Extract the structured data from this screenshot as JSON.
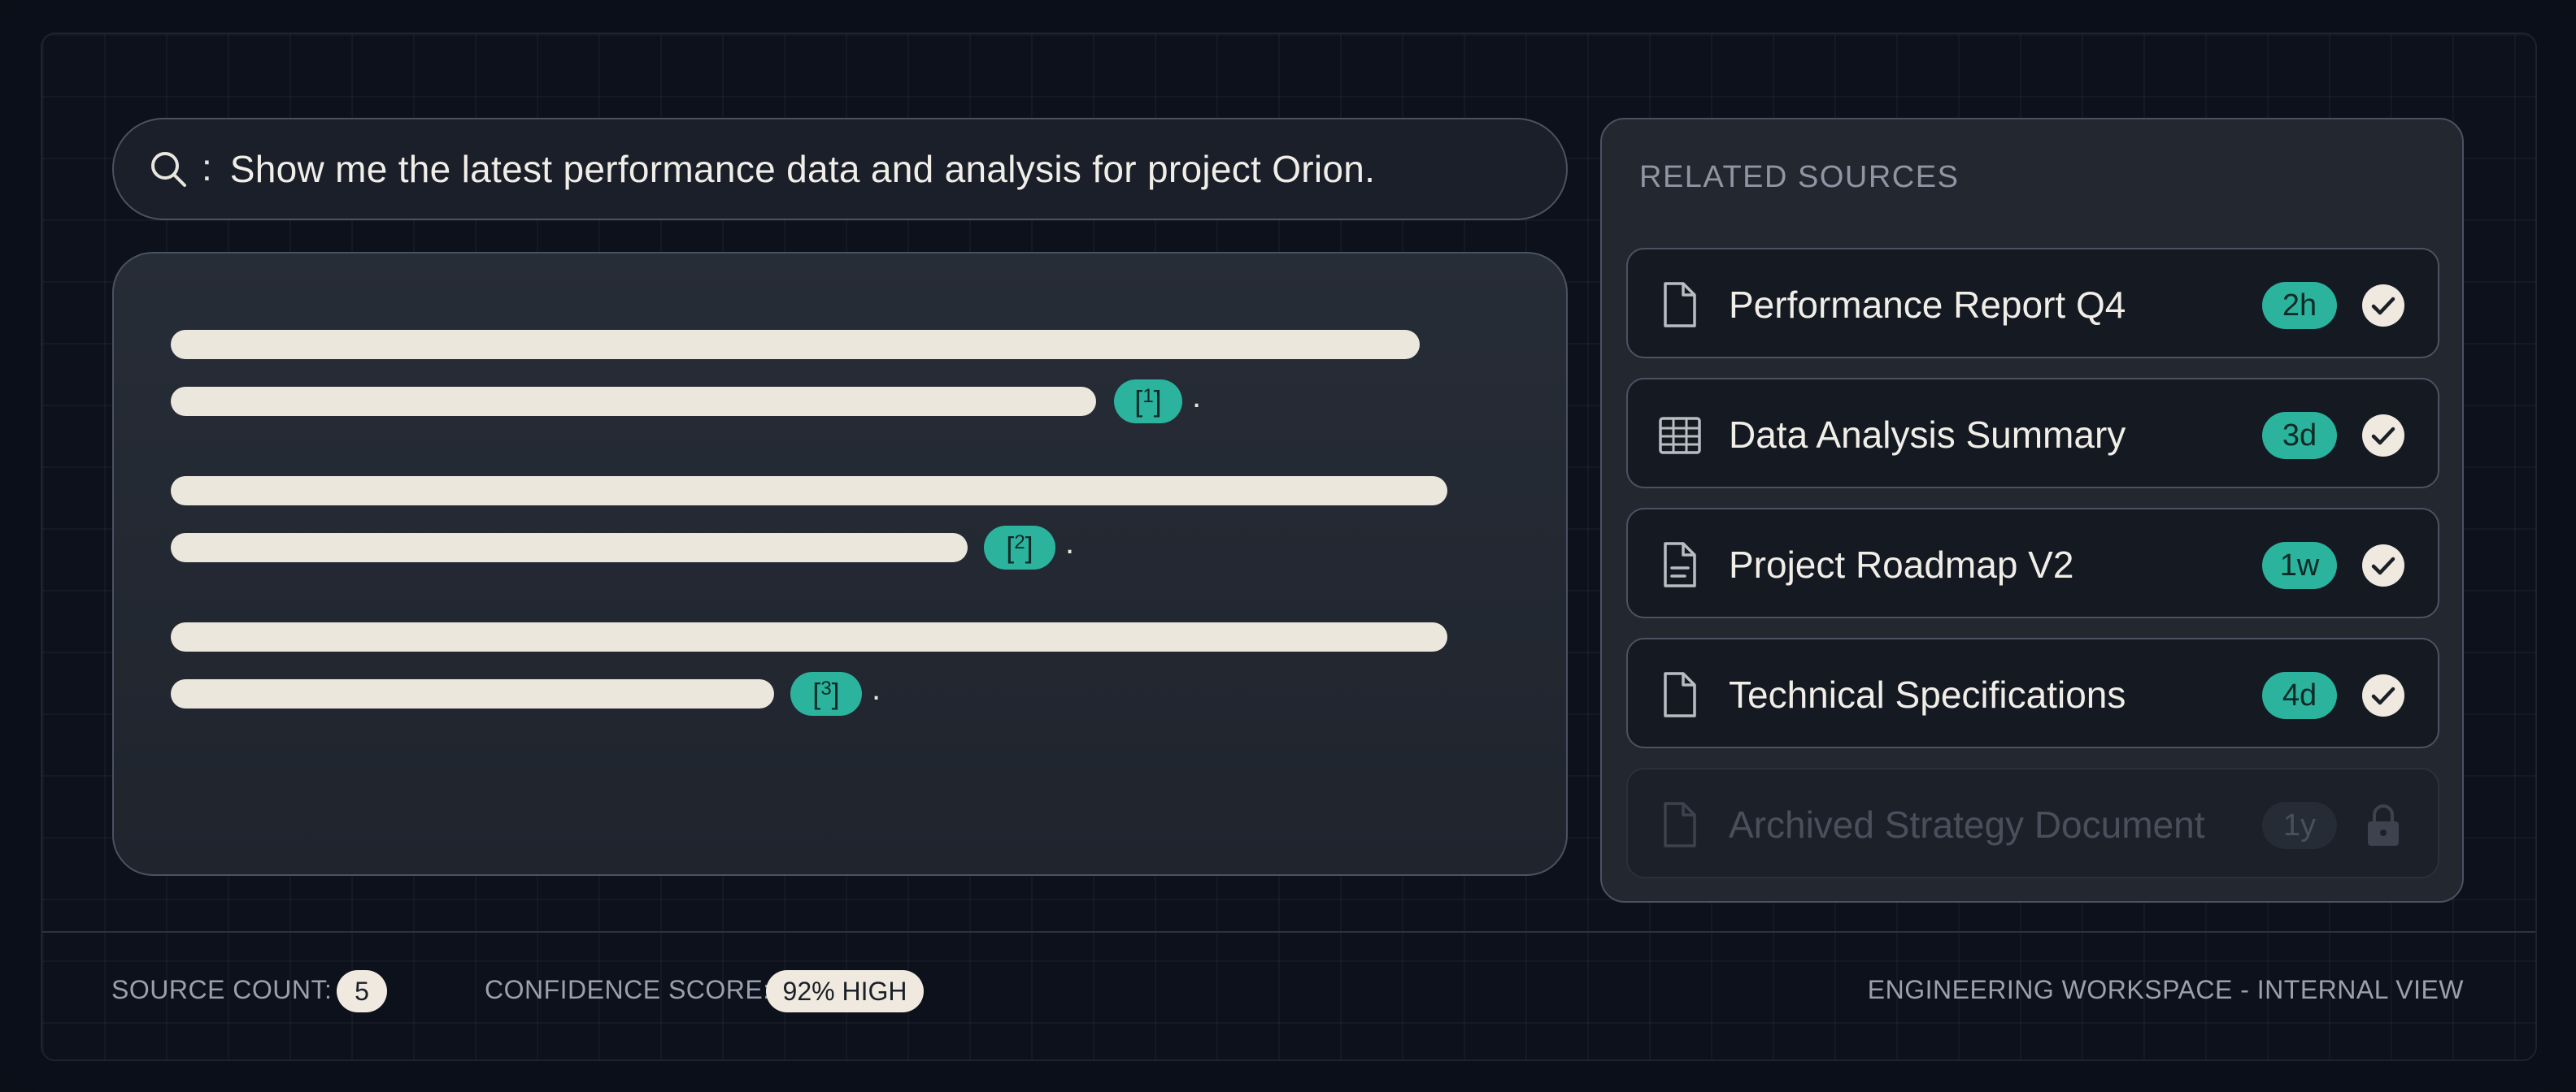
{
  "search": {
    "query": "Show me the latest performance data and analysis for project Orion."
  },
  "answer": {
    "citations": [
      {
        "number": "1"
      },
      {
        "number": "2"
      },
      {
        "number": "3"
      }
    ]
  },
  "sources": {
    "title": "RELATED SOURCES",
    "items": [
      {
        "label": "Performance Report Q4",
        "age": "2h",
        "icon": "document-icon",
        "status": "verified"
      },
      {
        "label": "Data Analysis Summary",
        "age": "3d",
        "icon": "table-icon",
        "status": "verified"
      },
      {
        "label": "Project Roadmap V2",
        "age": "1w",
        "icon": "document-lines-icon",
        "status": "verified"
      },
      {
        "label": "Technical Specifications",
        "age": "4d",
        "icon": "document-icon",
        "status": "verified"
      },
      {
        "label": "Archived Strategy Document",
        "age": "1y",
        "icon": "document-icon",
        "status": "locked"
      }
    ]
  },
  "footer": {
    "source_count_label": "SOURCE COUNT:",
    "source_count_value": "5",
    "confidence_label": "CONFIDENCE SCORE:",
    "confidence_value": "92% HIGH",
    "workspace_label": "ENGINEERING WORKSPACE - INTERNAL VIEW"
  },
  "colors": {
    "accent": "#2bb39e",
    "background": "#0a0f1a",
    "panel": "#222730",
    "text": "#f1eee8",
    "muted": "#9aa1ad"
  }
}
